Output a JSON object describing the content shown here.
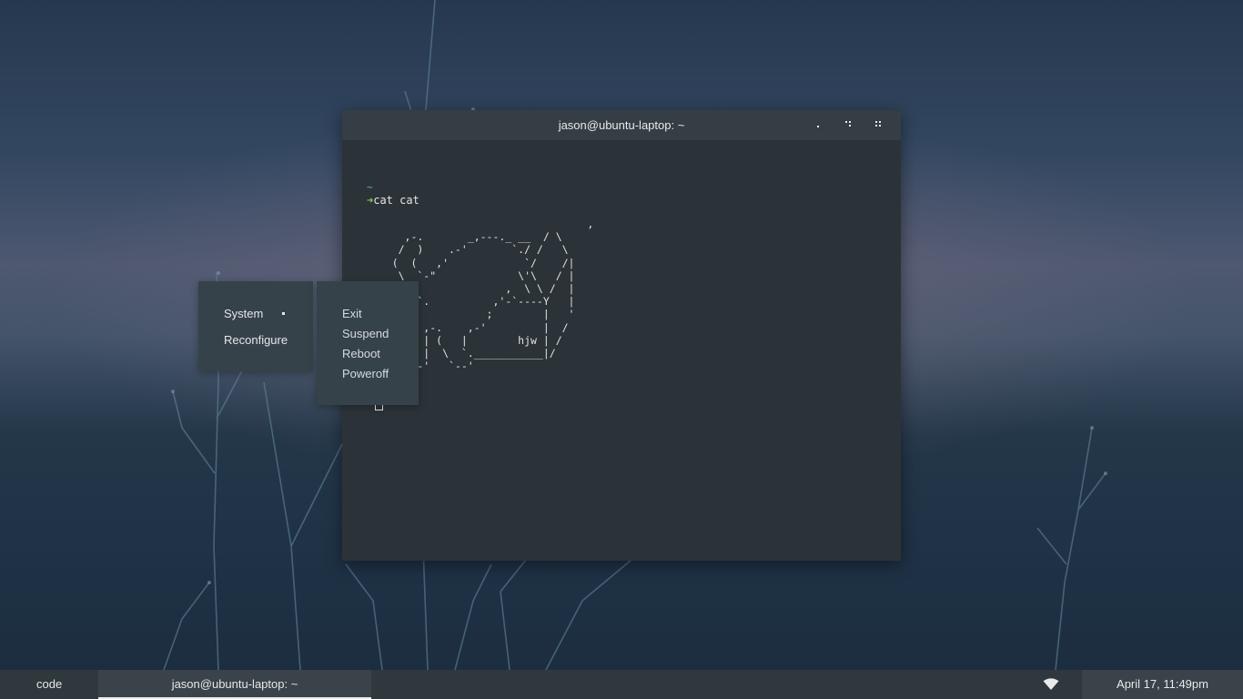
{
  "terminal": {
    "title": "jason@ubuntu-laptop: ~",
    "tilde": "~",
    "arrow": "➜",
    "command": "cat cat",
    "ascii_art": "                                   ,\n      ,-.       _,---._ __  / \\\n     /  )    .-'       `./ /   \\\n    (  (   ,'            `/    /|\n     \\  `-\"             \\'\\   / |\n      `.              ,  \\ \\ /  |\n       /`.          ,'-`----Y   |\n      (            ;        |   '\n      |  ,-.    ,-'         |  /\n      |  | (   |        hjw | /\n      )  |  \\  `.___________|/\n      `--'   `--'"
  },
  "menu": {
    "main": [
      "System",
      "Reconfigure"
    ],
    "sub": [
      "Exit",
      "Suspend",
      "Reboot",
      "Poweroff"
    ]
  },
  "taskbar": {
    "tasks": [
      "code",
      "jason@ubuntu-laptop: ~"
    ],
    "wifi_icon": "wifi-icon",
    "clock": "April 17, 11:49pm"
  },
  "colors": {
    "terminal_bg": "#2b3338",
    "titlebar_bg": "#353e44",
    "prompt_arrow": "#8fc25a",
    "prompt_tilde": "#5ab4dc",
    "taskbar_bg": "#2f383d"
  }
}
